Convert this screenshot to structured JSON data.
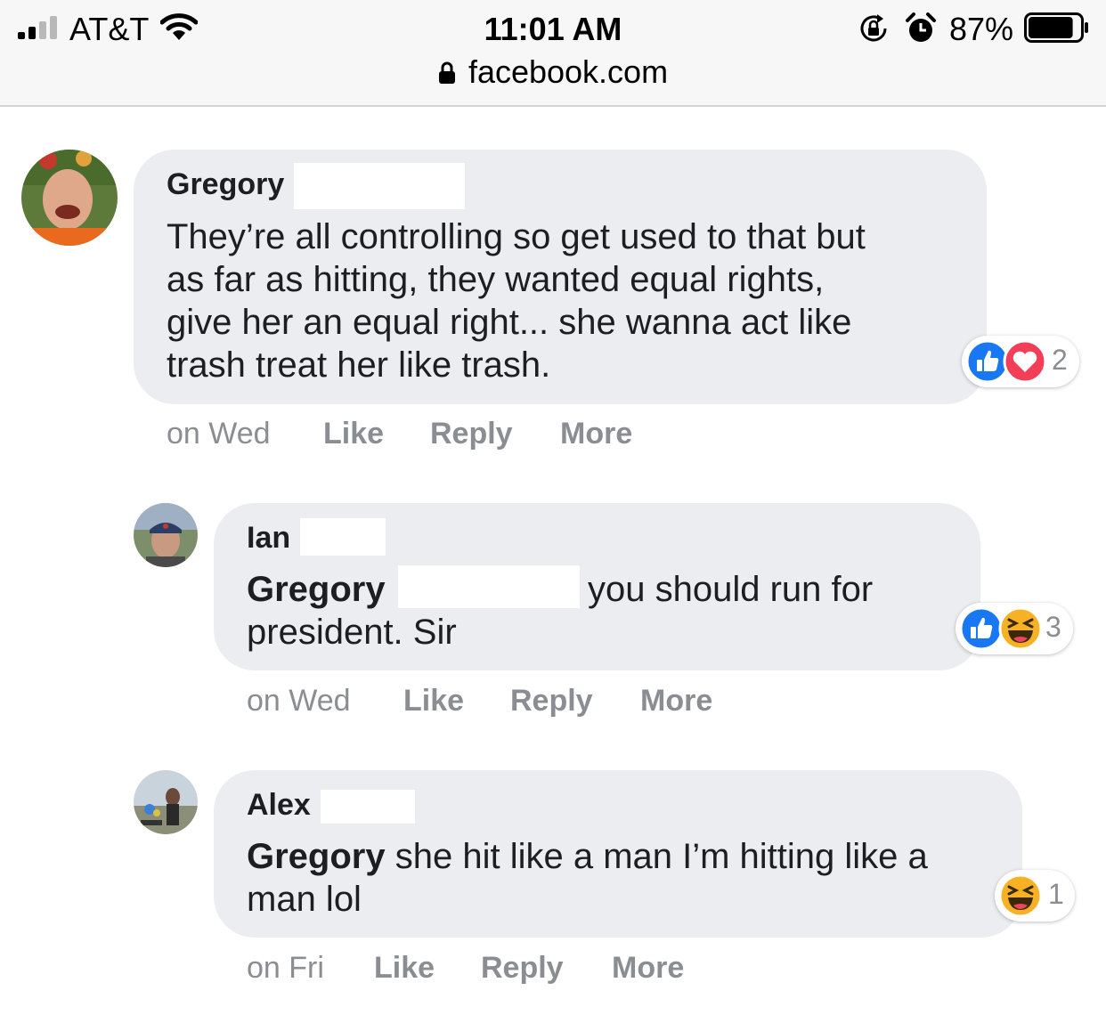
{
  "status_bar": {
    "carrier": "AT&T",
    "time": "11:01 AM",
    "url": "facebook.com",
    "battery": "87%",
    "battery_level": 0.87,
    "icons": [
      "signal-bars-icon",
      "wifi-icon",
      "lock-icon",
      "rotation-lock-icon",
      "alarm-icon",
      "battery-icon"
    ]
  },
  "comments": [
    {
      "author": "Gregory",
      "lines": [
        "They’re all controlling so get used to that but",
        "as far as hitting, they wanted equal rights,",
        "give her an equal right... she wanna act like",
        "trash treat her like trash."
      ],
      "reactions": {
        "icons": [
          "like-reaction-icon",
          "love-reaction-icon"
        ],
        "count": "2"
      },
      "actions": {
        "time": "on Wed",
        "like": "Like",
        "reply": "Reply",
        "more": "More"
      }
    },
    {
      "author": "Ian",
      "mention": "Gregory",
      "line1_rest": "you should run for",
      "line2": "president. Sir",
      "reactions": {
        "icons": [
          "like-reaction-icon",
          "haha-reaction-icon"
        ],
        "count": "3"
      },
      "actions": {
        "time": "on Wed",
        "like": "Like",
        "reply": "Reply",
        "more": "More"
      }
    },
    {
      "author": "Alex",
      "mention": "Gregory",
      "line1_rest": "she hit like a man I’m hitting like a",
      "line2": "man lol",
      "reactions": {
        "icons": [
          "haha-reaction-icon"
        ],
        "count": "1"
      },
      "actions": {
        "time": "on Fri",
        "like": "Like",
        "reply": "Reply",
        "more": "More"
      }
    }
  ],
  "colors": {
    "bubble": "#ebedf0",
    "meta_text": "#8a8d91",
    "like_blue": "#1877f2",
    "love_red": "#f33e58",
    "haha_yellow": "#f7b125"
  }
}
